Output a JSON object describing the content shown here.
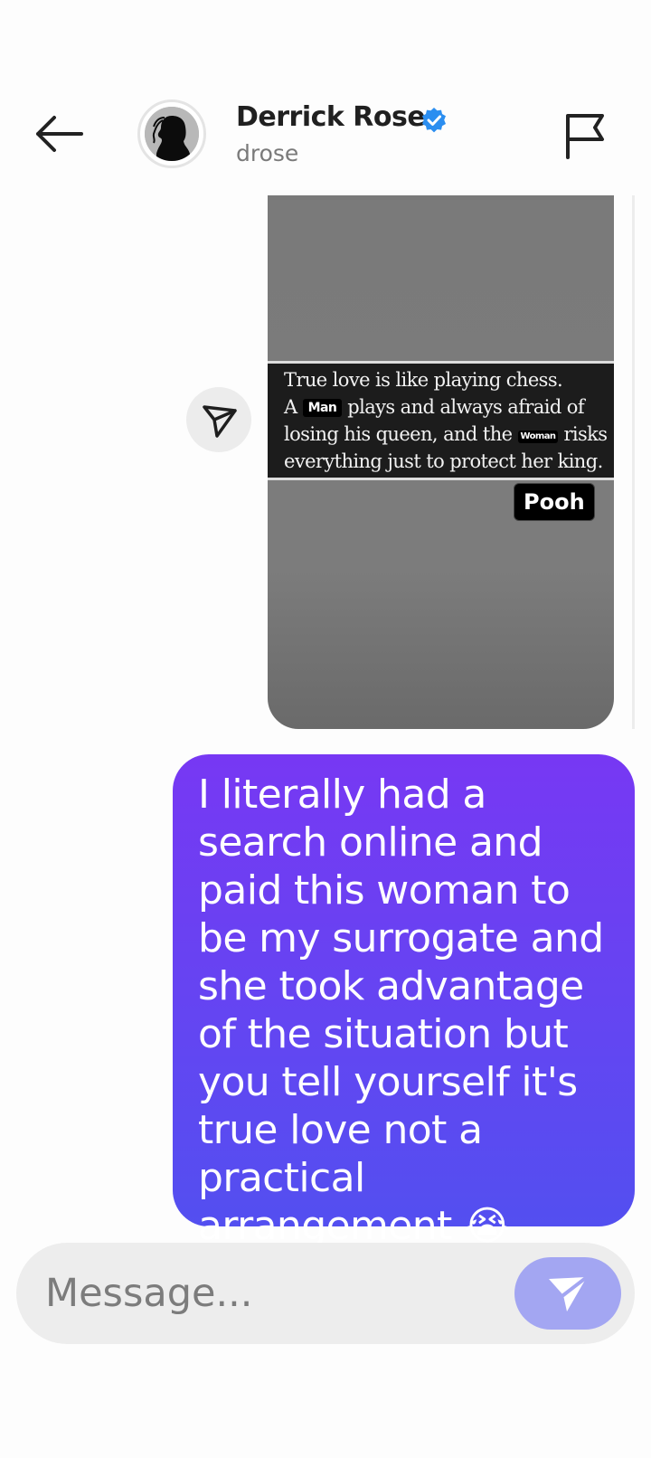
{
  "header": {
    "back_icon": "arrow-left-icon",
    "display_name": "Derrick Rose",
    "verified_icon": "verified-badge-icon",
    "verified_color": "#2b8ef0",
    "handle": "drose",
    "report_icon": "flag-icon"
  },
  "media": {
    "quote": {
      "line1": "True love is like playing chess.",
      "line2_a": "A",
      "line2_tag": "Man",
      "line2_b": "plays and always afraid of",
      "line3_a": "losing his queen, and the",
      "line3_tag": "Woman",
      "line3_b": "risks",
      "line4": "everything just to protect her king."
    },
    "watermark": "Pooh",
    "share_icon": "send-paper-plane-icon"
  },
  "messages": [
    {
      "direction": "outgoing",
      "text": "I literally had a search online and paid this woman to be my surrogate and she took advantage of the situation but you tell yourself it's true love not a practical arrangement 😭"
    }
  ],
  "composer": {
    "placeholder": "Message...",
    "value": "",
    "send_icon": "send-paper-plane-icon"
  },
  "colors": {
    "bubble_top": "#7738f3",
    "bubble_bottom": "#534ff0",
    "send_button": "#a3a6f2"
  }
}
